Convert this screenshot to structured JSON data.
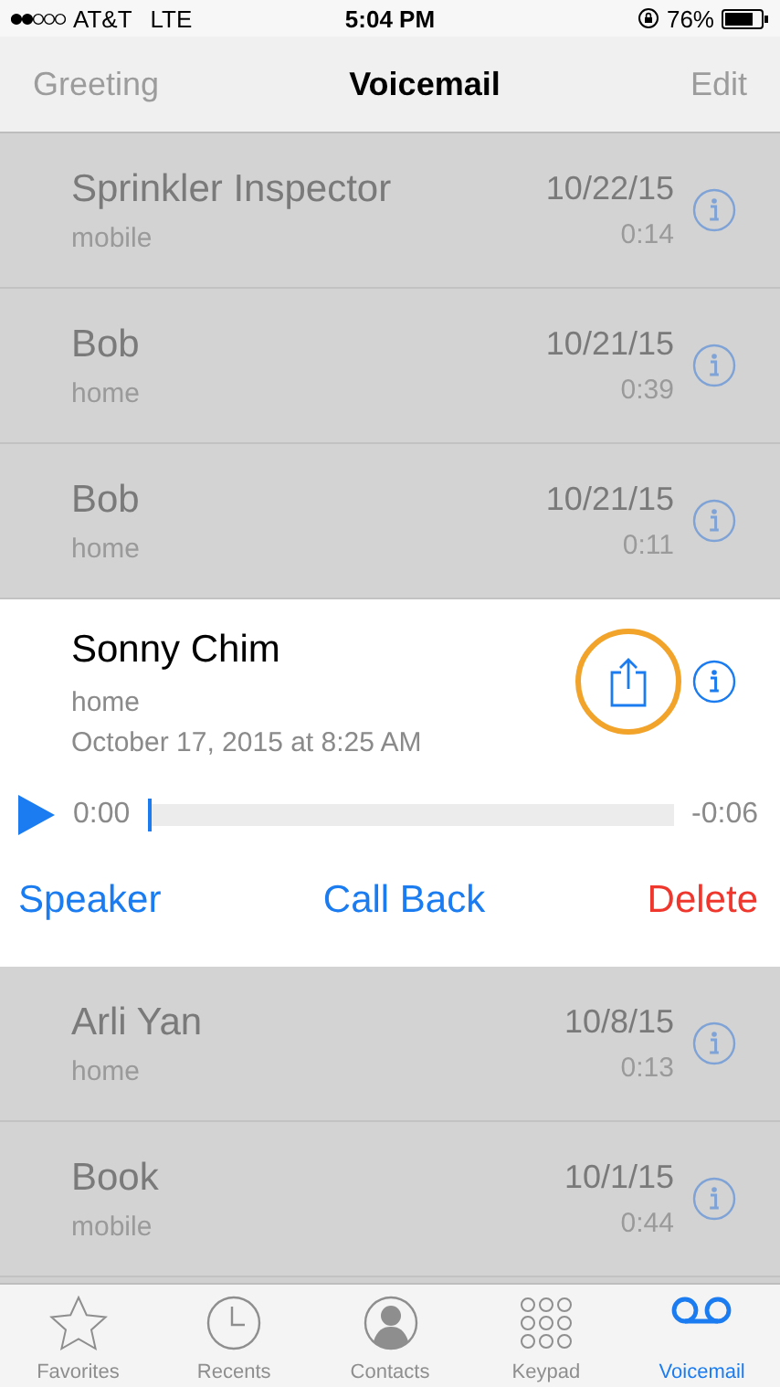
{
  "status_bar": {
    "carrier": "AT&T",
    "network": "LTE",
    "time": "5:04 PM",
    "battery": "76%"
  },
  "nav": {
    "left": {
      "label": "Greeting",
      "disabled": true
    },
    "title": "Voicemail",
    "right": {
      "label": "Edit",
      "disabled": true
    }
  },
  "messages": [
    {
      "name": "Sprinkler Inspector",
      "label": "mobile",
      "date": "10/22/15",
      "duration": "0:14",
      "expanded": false
    },
    {
      "name": "Bob",
      "label": "home",
      "date": "10/21/15",
      "duration": "0:39",
      "expanded": false
    },
    {
      "name": "Bob",
      "label": "home",
      "date": "10/21/15",
      "duration": "0:11",
      "expanded": false
    },
    {
      "name": "Sonny Chim",
      "label": "home",
      "timestamp": "October 17, 2015 at 8:25 AM",
      "elapsed": "0:00",
      "remaining": "-0:06",
      "actions": [
        {
          "label": "Speaker",
          "kind": "normal"
        },
        {
          "label": "Call Back",
          "kind": "normal"
        },
        {
          "label": "Delete",
          "kind": "destructive"
        }
      ],
      "expanded": true
    },
    {
      "name": "Arli Yan",
      "label": "home",
      "date": "10/8/15",
      "duration": "0:13",
      "expanded": false
    },
    {
      "name": "Book",
      "label": "mobile",
      "date": "10/1/15",
      "duration": "0:44",
      "expanded": false
    }
  ],
  "tabs": [
    {
      "label": "Favorites",
      "selected": false
    },
    {
      "label": "Recents",
      "selected": false
    },
    {
      "label": "Contacts",
      "selected": false
    },
    {
      "label": "Keypad",
      "selected": false
    },
    {
      "label": "Voicemail",
      "selected": true
    }
  ]
}
